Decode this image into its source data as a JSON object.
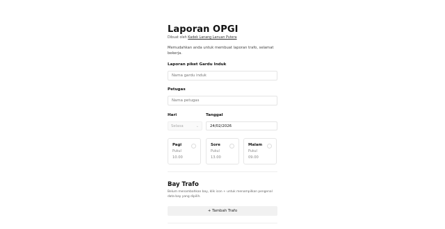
{
  "header": {
    "title": "Laporan OPGI",
    "byline_prefix": "Dibuat oleh",
    "byline_author": "Kadek Lanang Lanuan Putera",
    "intro": "Memudahkan anda untuk membuat laporan trafo, selamat bekerja."
  },
  "form": {
    "gardu": {
      "label": "Laporan piket Gardu Induk",
      "placeholder": "Nama gardu induk",
      "value": ""
    },
    "petugas": {
      "label": "Petugas",
      "placeholder": "Nama petugas",
      "value": ""
    },
    "hari": {
      "label": "Hari",
      "selected": "Selasa"
    },
    "tanggal": {
      "label": "Tanggal",
      "value": "24/02/2026"
    },
    "shifts": [
      {
        "name": "Pagi",
        "time_label": "Pukul",
        "time": "10.00"
      },
      {
        "name": "Sore",
        "time_label": "Pukul",
        "time": "13.00"
      },
      {
        "name": "Malam",
        "time_label": "Pukul",
        "time": "09.00"
      }
    ]
  },
  "bay_trafo": {
    "title": "Bay Trafo",
    "description": "Belum menambahkan bay, klik icon + untuk menampilkan pengenal data bay yang dipilih.",
    "add_button": "+ Tambah Trafo"
  },
  "icons": {
    "select_chevron": "chevron-down-icon"
  },
  "colors": {
    "field_border": "#e4e4e4",
    "button_bg": "#f1f1f1",
    "text": "#111111"
  }
}
